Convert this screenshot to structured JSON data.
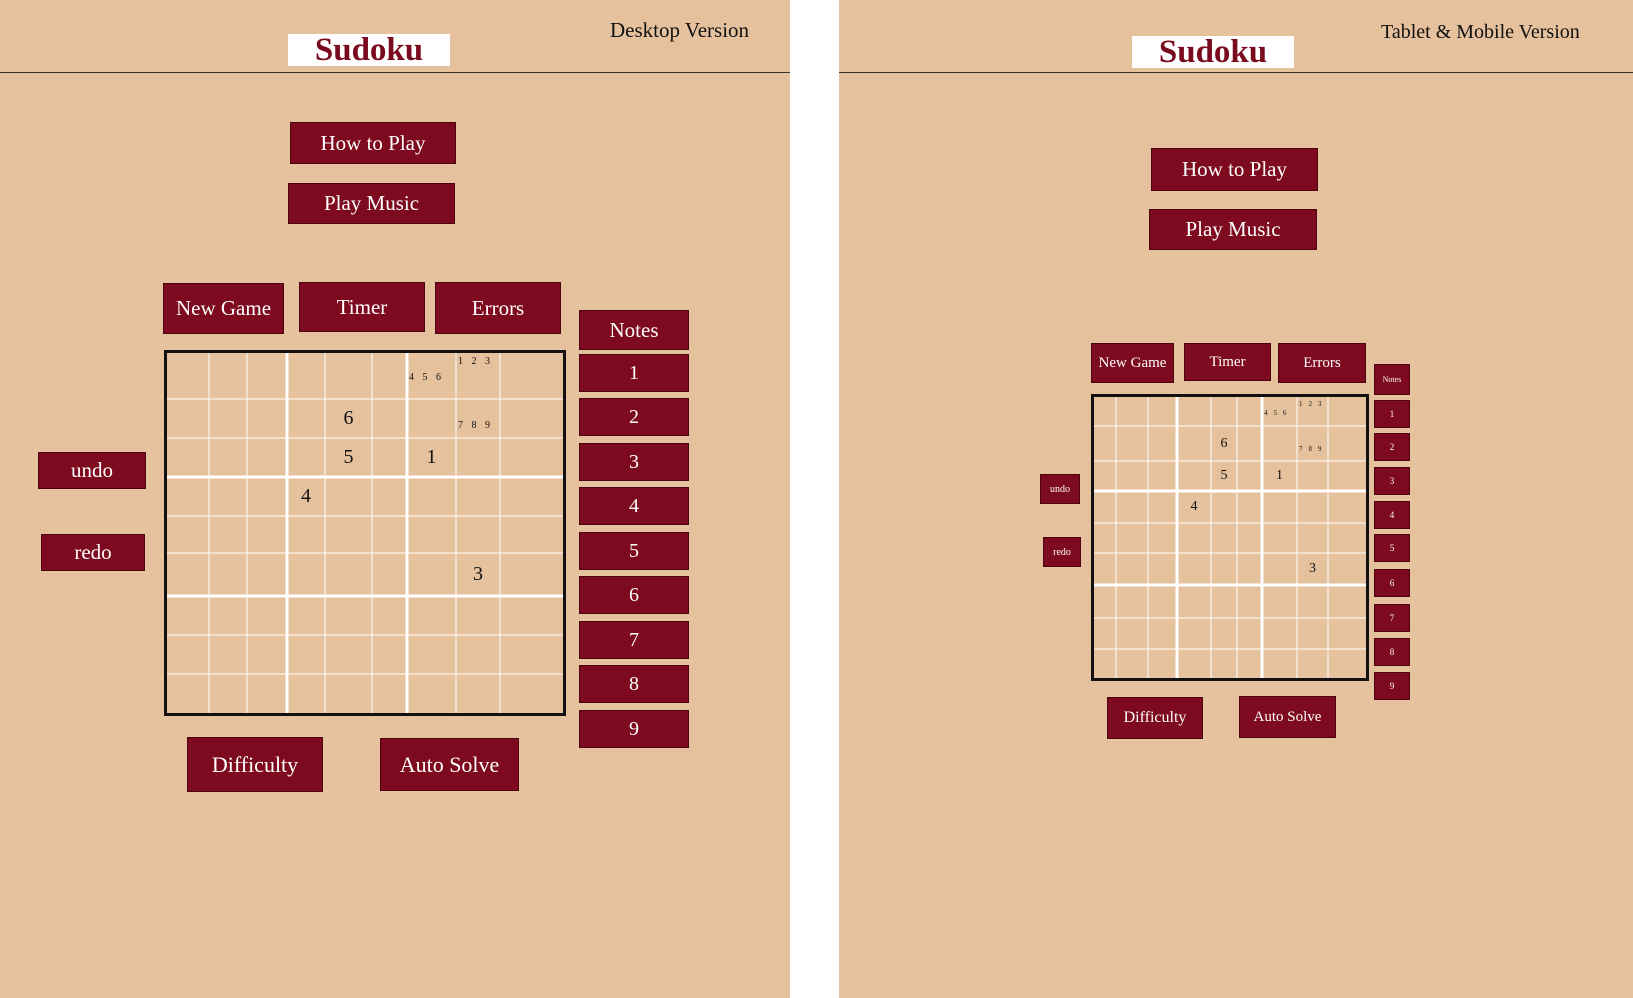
{
  "desktop": {
    "version_label": "Desktop Version",
    "logo": "Sudoku",
    "how_to_play": "How to Play",
    "play_music": "Play Music",
    "new_game": "New Game",
    "timer": "Timer",
    "errors": "Errors",
    "notes": "Notes",
    "numbers": [
      "1",
      "2",
      "3",
      "4",
      "5",
      "6",
      "7",
      "8",
      "9"
    ],
    "undo": "undo",
    "redo": "redo",
    "difficulty": "Difficulty",
    "auto_solve": "Auto Solve",
    "grid": {
      "values": [
        {
          "row": 1,
          "col": 4,
          "value": "6"
        },
        {
          "row": 2,
          "col": 4,
          "value": "5"
        },
        {
          "row": 2,
          "col": 6,
          "value": "1"
        },
        {
          "row": 3,
          "col": 3,
          "value": "4"
        },
        {
          "row": 5,
          "col": 7,
          "value": "3"
        }
      ],
      "notes": [
        {
          "row": 0,
          "col": 6,
          "text": "4 5 6"
        },
        {
          "row": 0,
          "col": 7,
          "text": "1 2 3"
        },
        {
          "row": 1,
          "col": 7,
          "text": "7 8 9"
        }
      ]
    }
  },
  "mobile": {
    "version_label": "Tablet & Mobile Version",
    "logo": "Sudoku",
    "how_to_play": "How to Play",
    "play_music": "Play Music",
    "new_game": "New Game",
    "timer": "Timer",
    "errors": "Errors",
    "notes": "Notes",
    "numbers": [
      "1",
      "2",
      "3",
      "4",
      "5",
      "6",
      "7",
      "8",
      "9"
    ],
    "undo": "undo",
    "redo": "redo",
    "difficulty": "Difficulty",
    "auto_solve": "Auto Solve",
    "grid": {
      "values": [
        {
          "row": 1,
          "col": 4,
          "value": "6"
        },
        {
          "row": 2,
          "col": 4,
          "value": "5"
        },
        {
          "row": 2,
          "col": 6,
          "value": "1"
        },
        {
          "row": 3,
          "col": 3,
          "value": "4"
        },
        {
          "row": 5,
          "col": 7,
          "value": "3"
        }
      ],
      "notes": [
        {
          "row": 0,
          "col": 6,
          "text": "4 5 6"
        },
        {
          "row": 0,
          "col": 7,
          "text": "1 2 3"
        },
        {
          "row": 1,
          "col": 7,
          "text": "7 8 9"
        }
      ]
    }
  },
  "colors": {
    "background": "#e5c19d",
    "button": "#7d0a1e",
    "button_text": "#ffffff",
    "logo_text": "#7a0b1f"
  }
}
